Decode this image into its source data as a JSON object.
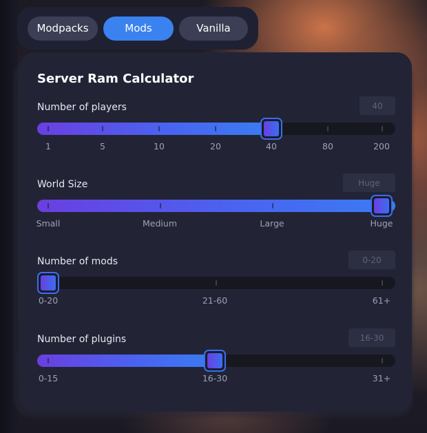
{
  "tabs": {
    "modpacks": "Modpacks",
    "mods": "Mods",
    "vanilla": "Vanilla"
  },
  "calculator": {
    "title": "Server Ram Calculator",
    "players": {
      "label": "Number of players",
      "value": "40",
      "ticks": [
        "1",
        "5",
        "10",
        "20",
        "40",
        "80",
        "200"
      ],
      "selected_index": 4
    },
    "world_size": {
      "label": "World Size",
      "value": "Huge",
      "ticks": [
        "Small",
        "Medium",
        "Large",
        "Huge"
      ],
      "selected_index": 3
    },
    "mods": {
      "label": "Number of mods",
      "value": "0-20",
      "ticks": [
        "0-20",
        "21-60",
        "61+"
      ],
      "selected_index": 0
    },
    "plugins": {
      "label": "Number of plugins",
      "value": "16-30",
      "ticks": [
        "0-15",
        "16-30",
        "31+"
      ],
      "selected_index": 1
    }
  },
  "colors": {
    "accent": "#3a82f0",
    "gradient_start": "#6a3fe0",
    "card": "#222436"
  }
}
